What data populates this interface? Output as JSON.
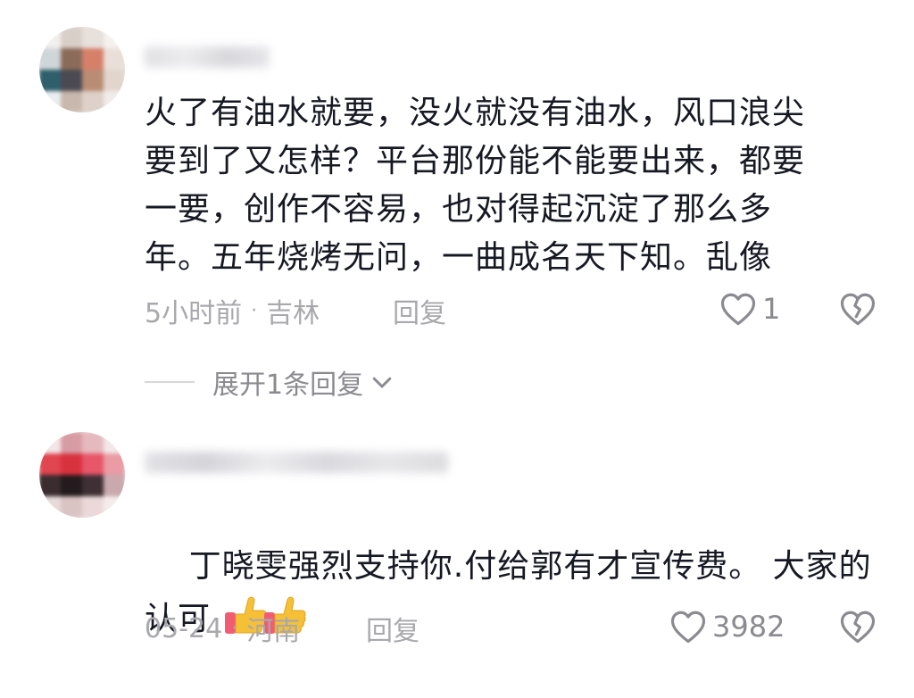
{
  "comments": [
    {
      "text": "火了有油水就要，没火就没有油水，风口浪尖\n要到了又怎样？平台那份能不能要出来，都要\n一要，创作不容易，也对得起沉淀了那么多\n年。五年烧烤无问，一曲成名天下知。乱像",
      "time": "5小时前",
      "location": "吉林",
      "reply_label": "回复",
      "like_count": "1",
      "expand_label": "展开1条回复"
    },
    {
      "text": "丁晓雯强烈支持你.付给郭有才宣传费。 大家的\n认可 ",
      "time": "05-24",
      "location": "河南",
      "reply_label": "回复",
      "like_count": "3982"
    }
  ],
  "icons": {
    "like": "heart-outline-icon",
    "dislike": "broken-heart-icon",
    "expand": "chevron-down-icon",
    "emoji": "thumbs-up-emoji"
  },
  "colors": {
    "text": "#161823",
    "meta": "#a8a8ad",
    "icon": "#8a8a90",
    "thumb": "#f5c036",
    "thumb_cuff": "#f25b74"
  }
}
